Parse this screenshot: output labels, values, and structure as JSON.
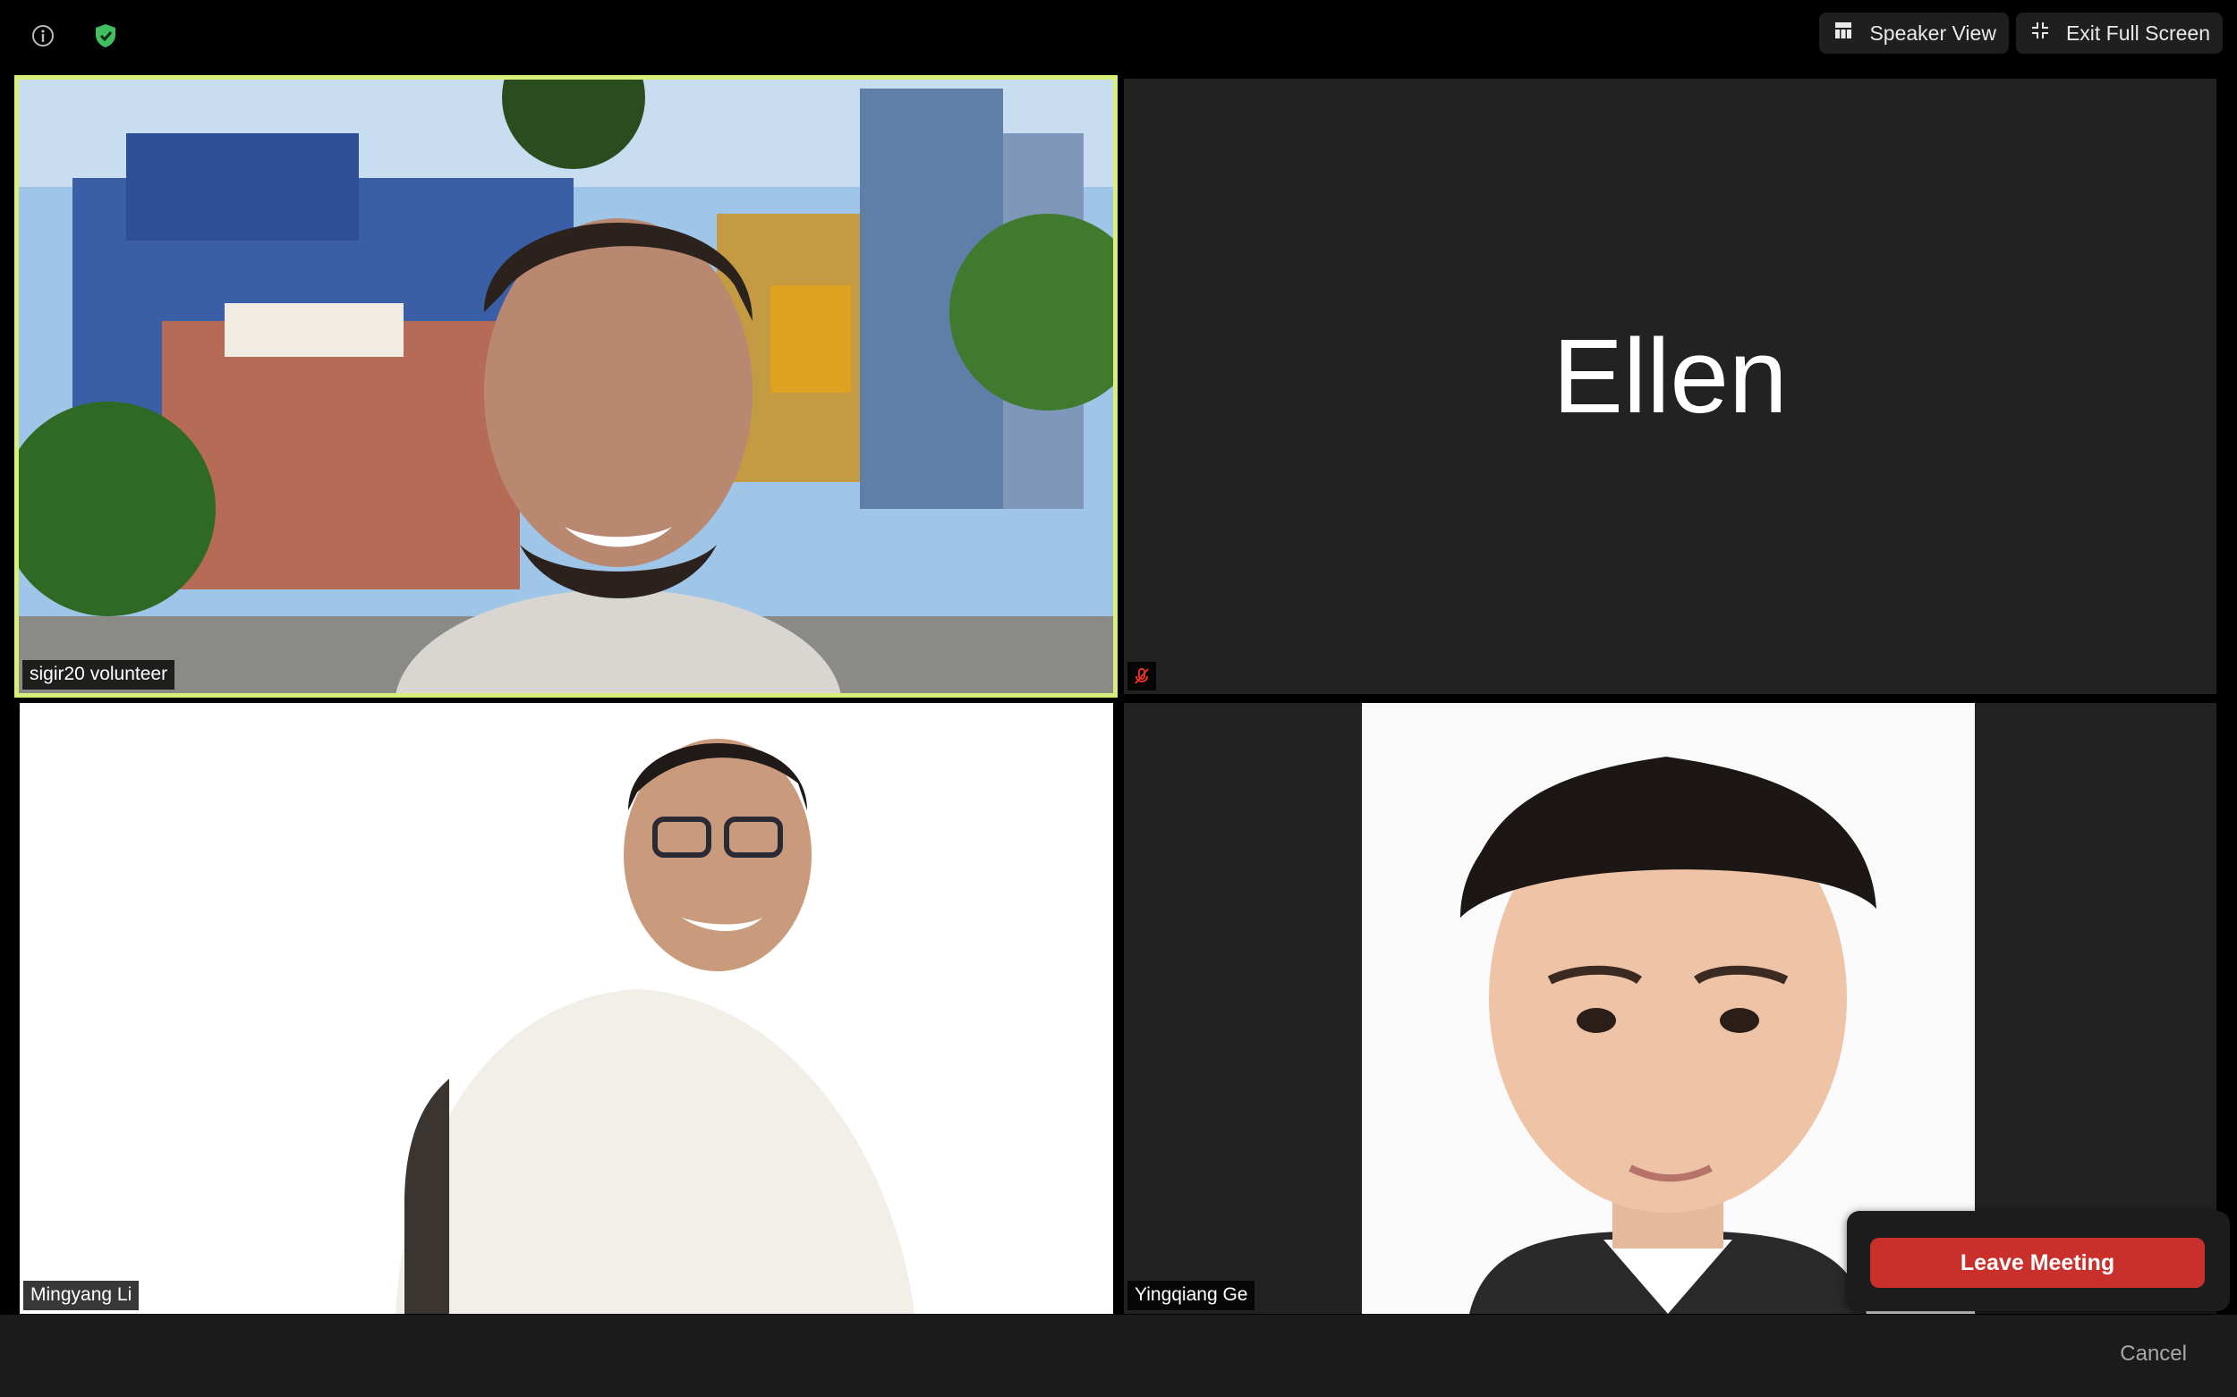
{
  "top_bar": {
    "info_icon": "info-icon",
    "security_icon": "shield-check-icon",
    "security_color": "#3fbf5f",
    "speaker_view_label": "Speaker View",
    "exit_fullscreen_label": "Exit Full Screen"
  },
  "participants": [
    {
      "name": "sigir20 volunteer",
      "active_speaker": true,
      "highlight_color": "#d8f07a"
    },
    {
      "name": "Ellen",
      "video": false,
      "muted": true,
      "muted_icon_color": "#e0312a"
    },
    {
      "name": "Mingyang Li"
    },
    {
      "name": "Yingqiang Ge"
    }
  ],
  "leave_popover": {
    "leave_label": "Leave Meeting",
    "leave_color": "#c9302c"
  },
  "bottom_bar": {
    "cancel_label": "Cancel"
  }
}
